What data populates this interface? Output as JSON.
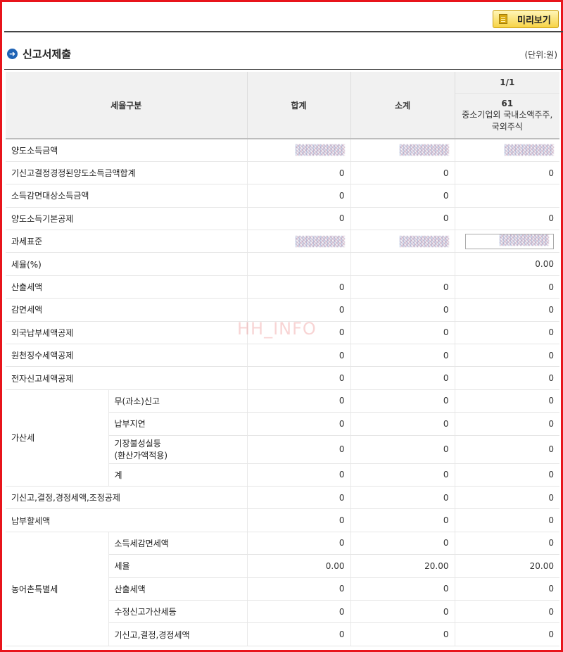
{
  "toolbar": {
    "preview_label": "미리보기"
  },
  "section": {
    "title": "신고서제출",
    "unit": "(단위:원)"
  },
  "table": {
    "header": {
      "category": "세율구분",
      "total": "합계",
      "subtotal": "소계",
      "page": "1/1",
      "col_code": "61",
      "col_name": "중소기업외 국내소액주주,국외주식"
    },
    "rows": [
      {
        "label": "양도소득금액",
        "total": "",
        "subtotal": "",
        "col1": ""
      },
      {
        "label": "기신고결정경정된양도소득금액합계",
        "total": "0",
        "subtotal": "0",
        "col1": "0"
      },
      {
        "label": "소득감면대상소득금액",
        "total": "0",
        "subtotal": "0",
        "col1": ""
      },
      {
        "label": "양도소득기본공제",
        "total": "0",
        "subtotal": "0",
        "col1": "0"
      },
      {
        "label": "과세표준",
        "total": "",
        "subtotal": "",
        "col1": ""
      },
      {
        "label": "세율(%)",
        "total": "",
        "subtotal": "",
        "col1": "0.00"
      },
      {
        "label": "산출세액",
        "total": "0",
        "subtotal": "0",
        "col1": "0"
      },
      {
        "label": "감면세액",
        "total": "0",
        "subtotal": "0",
        "col1": "0"
      },
      {
        "label": "외국납부세액공제",
        "total": "0",
        "subtotal": "0",
        "col1": "0"
      },
      {
        "label": "원천징수세액공제",
        "total": "0",
        "subtotal": "0",
        "col1": "0"
      },
      {
        "label": "전자신고세액공제",
        "total": "0",
        "subtotal": "0",
        "col1": "0"
      }
    ],
    "penalty": {
      "group": "가산세",
      "items": [
        {
          "label": "무(과소)신고",
          "total": "0",
          "subtotal": "0",
          "col1": "0"
        },
        {
          "label": "납부지연",
          "total": "0",
          "subtotal": "0",
          "col1": "0"
        },
        {
          "label1": "기장불성실등",
          "label2": "(환산가액적용)",
          "total": "0",
          "subtotal": "0",
          "col1": "0"
        },
        {
          "label": "계",
          "total": "0",
          "subtotal": "0",
          "col1": "0"
        }
      ]
    },
    "rows2": [
      {
        "label": "기신고,결정,경정세액,조정공제",
        "total": "0",
        "subtotal": "0",
        "col1": "0"
      },
      {
        "label": "납부할세액",
        "total": "0",
        "subtotal": "0",
        "col1": "0"
      }
    ],
    "rural": {
      "group": "농어촌특별세",
      "items": [
        {
          "label": "소득세감면세액",
          "total": "0",
          "subtotal": "0",
          "col1": "0"
        },
        {
          "label": "세율",
          "total": "0.00",
          "subtotal": "20.00",
          "col1": "20.00"
        },
        {
          "label": "산출세액",
          "total": "0",
          "subtotal": "0",
          "col1": "0"
        },
        {
          "label": "수정신고가산세등",
          "total": "0",
          "subtotal": "0",
          "col1": "0"
        },
        {
          "label": "기신고,결정,경정세액",
          "total": "0",
          "subtotal": "0",
          "col1": "0"
        }
      ]
    }
  },
  "watermark": "HH_INFO"
}
